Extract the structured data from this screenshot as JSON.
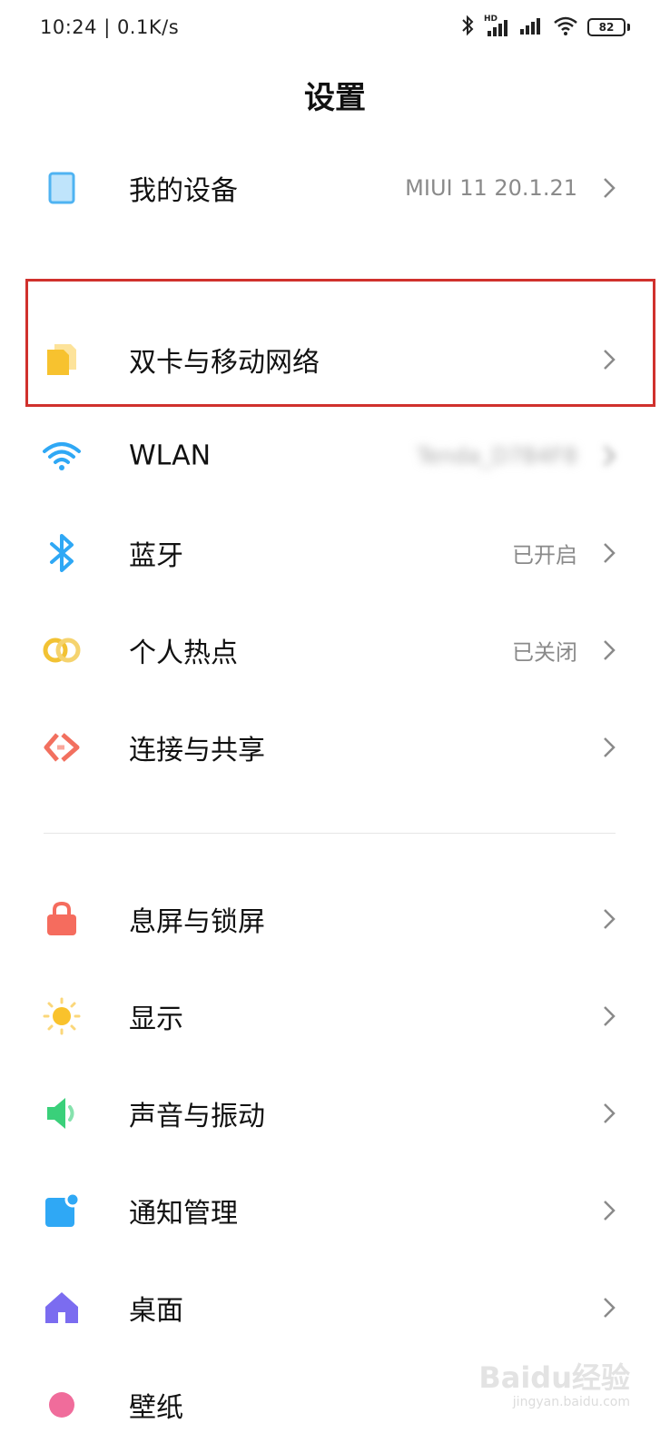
{
  "status_bar": {
    "time_speed": "10:24 | 0.1K/s",
    "signal_badge": "HD",
    "battery": "82",
    "icons": [
      "bluetooth-icon",
      "hd-signal-icon",
      "signal-icon",
      "wifi-icon",
      "battery-icon"
    ]
  },
  "page": {
    "title": "设置"
  },
  "my_device": {
    "label": "我的设备",
    "value": "MIUI 11 20.1.21",
    "icon": "phone-icon",
    "color": "#6cc3f7"
  },
  "network_items": [
    {
      "label": "双卡与移动网络",
      "value": "",
      "icon": "sim-card-icon",
      "color": "#f7c22f"
    },
    {
      "label": "WLAN",
      "value": "Tenda_D7B4F8",
      "icon": "wifi-icon",
      "color": "#2fa8f5"
    },
    {
      "label": "蓝牙",
      "value": "已开启",
      "icon": "bluetooth-icon",
      "color": "#2fa8f5"
    },
    {
      "label": "个人热点",
      "value": "已关闭",
      "icon": "hotspot-icon",
      "color": "#f2c233"
    },
    {
      "label": "连接与共享",
      "value": "",
      "icon": "share-icon",
      "color": "#f2705f"
    }
  ],
  "system_items": [
    {
      "label": "息屏与锁屏",
      "icon": "lock-icon",
      "color": "#f56c5e"
    },
    {
      "label": "显示",
      "icon": "sun-icon",
      "color": "#f9c22c"
    },
    {
      "label": "声音与振动",
      "icon": "speaker-icon",
      "color": "#3ad07a"
    },
    {
      "label": "通知管理",
      "icon": "notification-icon",
      "color": "#2fa8f5"
    },
    {
      "label": "桌面",
      "icon": "home-icon",
      "color": "#7b6cf0"
    },
    {
      "label": "壁纸",
      "icon": "wallpaper-icon",
      "color": "#f06c9b"
    }
  ],
  "watermark": {
    "text": "Baidu经验",
    "sub": "jingyan.baidu.com"
  }
}
